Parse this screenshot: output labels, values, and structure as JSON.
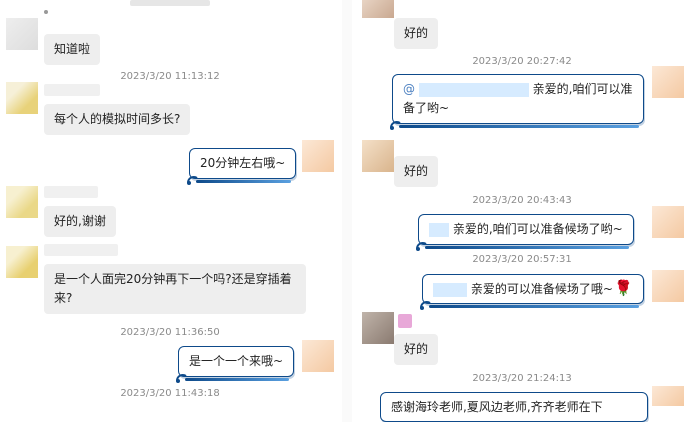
{
  "left": {
    "messages": [
      {
        "text": "知道啦"
      },
      {
        "text": "每个人的模拟时间多长?"
      },
      {
        "text": "20分钟左右哦~"
      },
      {
        "text": "好的,谢谢"
      },
      {
        "text": "是一个人面完20分钟再下一个吗?还是穿插着来?"
      },
      {
        "text": "是一个一个来哦~"
      }
    ],
    "timestamps": [
      "2023/3/20 11:13:12",
      "2023/3/20 11:36:50",
      "2023/3/20 11:43:18"
    ]
  },
  "right": {
    "messages": [
      {
        "text": "好的"
      },
      {
        "mention": "@",
        "text": "亲爱的,咱们可以准备了哟~"
      },
      {
        "text": "好的"
      },
      {
        "text": "亲爱的,咱们可以准备候场了哟~"
      },
      {
        "text": "亲爱的可以准备候场了哦~"
      },
      {
        "text": "好的"
      },
      {
        "text": "感谢海玲老师,夏风边老师,齐齐老师在下"
      }
    ],
    "timestamps": [
      "2023/3/20 20:27:42",
      "2023/3/20 20:43:43",
      "2023/3/20 20:57:31",
      "2023/3/20 21:24:13"
    ],
    "rose_emoji": "🌹"
  },
  "colors": {
    "bubble_gray": "#eeeeee",
    "bubble_border": "#0e4a8a",
    "timestamp": "#8a8a8a",
    "mention": "#4a7fc0"
  }
}
